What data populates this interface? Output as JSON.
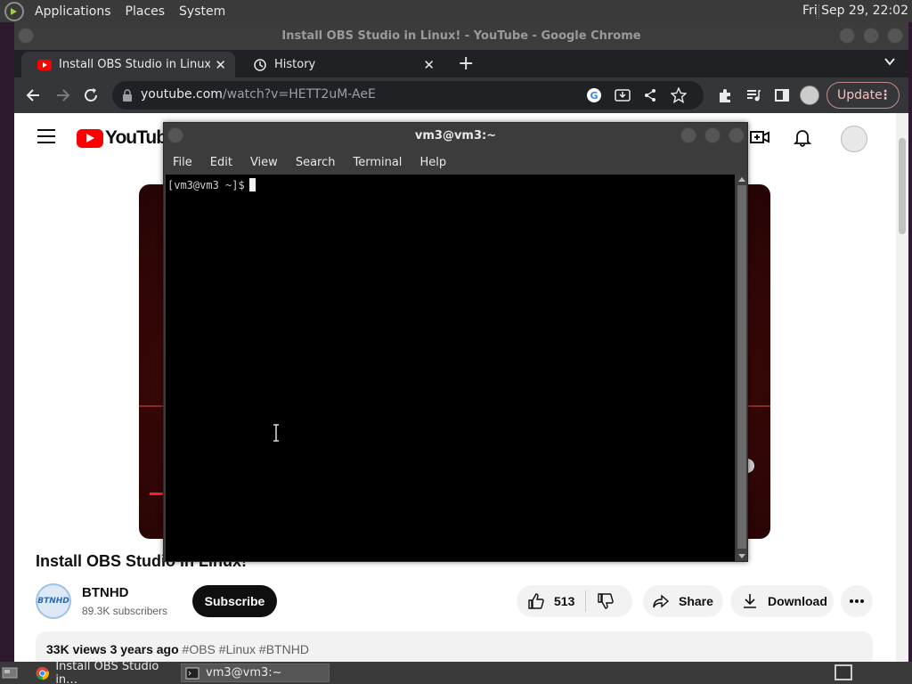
{
  "top_panel": {
    "menus": [
      "Applications",
      "Places",
      "System"
    ],
    "clock": "Fri Sep 29, 22:02"
  },
  "chrome": {
    "window_title": "Install OBS Studio in Linux! - YouTube - Google Chrome",
    "tabs": [
      {
        "label": "Install OBS Studio in Linux! - YouTube",
        "active": true
      },
      {
        "label": "History",
        "active": false
      }
    ],
    "url_host": "youtube.com",
    "url_path": "/watch?v=HETT2uM-AeE",
    "update_label": "Update"
  },
  "youtube": {
    "logo_text": "YouTube",
    "video_title": "Install OBS Studio in Linux!",
    "channel_name": "BTNHD",
    "channel_avatar_text": "BTNHD",
    "subscribers": "89.3K subscribers",
    "subscribe_label": "Subscribe",
    "likes": "513",
    "share_label": "Share",
    "download_label": "Download",
    "description_meta": "33K views  3 years ago",
    "description_tags": "#OBS #Linux #BTNHD"
  },
  "terminal": {
    "title": "vm3@vm3:~",
    "menus": [
      "File",
      "Edit",
      "View",
      "Search",
      "Terminal",
      "Help"
    ],
    "prompt": "[vm3@vm3 ~]$"
  },
  "taskbar": {
    "items": [
      {
        "label": "Install OBS Studio in…",
        "active": false
      },
      {
        "label": "vm3@vm3:~",
        "active": true
      }
    ]
  },
  "colors": {
    "youtube_red": "#ff0000",
    "chrome_dark": "#202124",
    "terminal_bg": "#000000"
  }
}
